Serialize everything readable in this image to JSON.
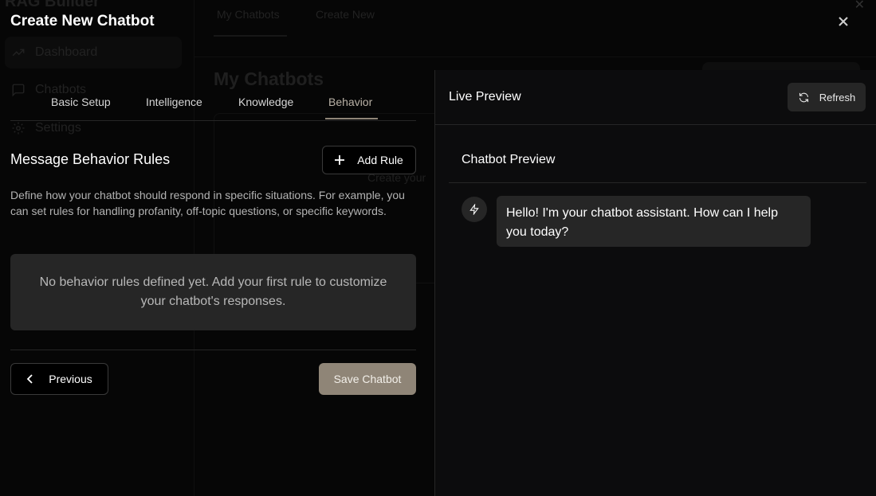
{
  "background": {
    "brand": "RAG Builder",
    "nav": [
      {
        "label": "Dashboard",
        "icon": "trending-up-icon"
      },
      {
        "label": "Chatbots",
        "icon": "message-square-icon"
      },
      {
        "label": "Settings",
        "icon": "gear-icon"
      }
    ],
    "tabs": [
      "My Chatbots",
      "Create New"
    ],
    "page_title": "My Chatbots",
    "card_text": "Create your"
  },
  "dialog": {
    "title": "Create New Chatbot",
    "tabs": [
      {
        "label": "Basic Setup",
        "active": false
      },
      {
        "label": "Intelligence",
        "active": false
      },
      {
        "label": "Knowledge",
        "active": false
      },
      {
        "label": "Behavior",
        "active": true
      }
    ],
    "section_title": "Message Behavior Rules",
    "add_rule_label": "Add Rule",
    "description": "Define how your chatbot should respond in specific situations. For example, you can set rules for handling profanity, off-topic questions, or specific keywords.",
    "empty_state": "No behavior rules defined yet. Add your first rule to customize your chatbot's responses.",
    "previous_label": "Previous",
    "save_label": "Save Chatbot"
  },
  "preview": {
    "title": "Live Preview",
    "refresh_label": "Refresh",
    "chat_title": "Chatbot Preview",
    "bot_message": "Hello! I'm your chatbot assistant. How can I help you today?"
  },
  "colors": {
    "accent": "#8f8577",
    "panel": "#262626",
    "background": "#000000"
  }
}
